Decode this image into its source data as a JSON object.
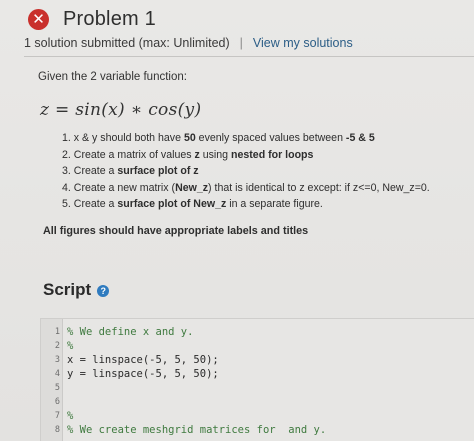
{
  "header": {
    "status_icon": "error-x-icon",
    "status_icon_glyph": "✕",
    "title": "Problem 1",
    "submission_info": "1 solution submitted (max: Unlimited)",
    "separator": "|",
    "view_solutions_link": "View my solutions"
  },
  "problem": {
    "given_label": "Given the 2 variable function:",
    "formula": "z = sin(x) ∗ cos(y)",
    "tasks": [
      {
        "number": "1.",
        "parts": [
          "x & y should both have ",
          "50",
          " evenly spaced values between ",
          "-5 & 5",
          ""
        ]
      },
      {
        "number": "2.",
        "parts": [
          "Create a matrix of values ",
          "z",
          " using ",
          "nested for loops",
          ""
        ]
      },
      {
        "number": "3.",
        "parts": [
          "Create a ",
          "surface plot of z",
          "",
          "",
          ""
        ]
      },
      {
        "number": "4.",
        "parts": [
          "Create a new matrix (",
          "New_z",
          ") that is identical to z except: if z<=0, New_z=0.",
          "",
          ""
        ]
      },
      {
        "number": "5.",
        "parts": [
          "Create a ",
          "surface plot of New_z",
          " in a separate figure.",
          "",
          ""
        ]
      }
    ],
    "note": "All figures should have appropriate labels and titles"
  },
  "script": {
    "heading": "Script",
    "help_icon": "help-question-icon",
    "help_glyph": "?",
    "lines": [
      {
        "num": "1",
        "text": "% We define x and y.",
        "comment": true
      },
      {
        "num": "2",
        "text": "%",
        "comment": true
      },
      {
        "num": "3",
        "text": "x = linspace(-5, 5, 50);",
        "comment": false
      },
      {
        "num": "4",
        "text": "y = linspace(-5, 5, 50);",
        "comment": false
      },
      {
        "num": "5",
        "text": "",
        "comment": false
      },
      {
        "num": "6",
        "text": "",
        "comment": false
      },
      {
        "num": "7",
        "text": "%",
        "comment": true
      },
      {
        "num": "8",
        "text": "% We create meshgrid matrices for  and y.",
        "comment": true
      }
    ]
  },
  "colors": {
    "error": "#c9302c",
    "link": "#2b5d86",
    "help": "#2f7bbf",
    "comment": "#3f7a3f"
  }
}
